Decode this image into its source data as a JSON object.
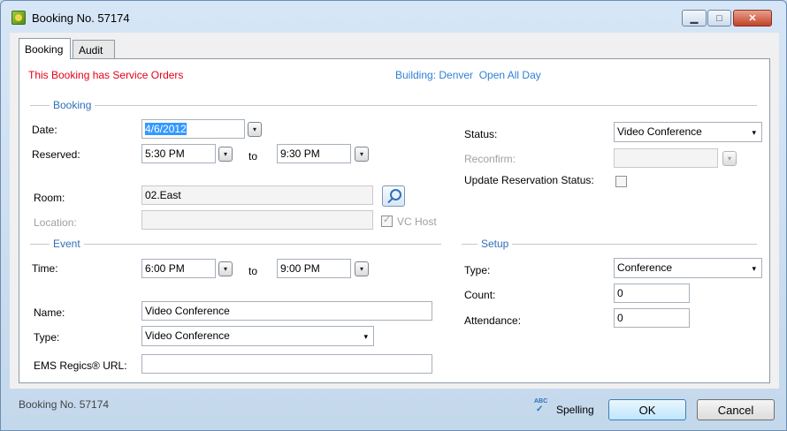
{
  "window": {
    "title": "Booking No. 57174"
  },
  "tabs": [
    {
      "label": "Booking"
    },
    {
      "label": "Audit"
    }
  ],
  "notice": "This Booking has Service Orders",
  "building_info": "Building: Denver  Open All Day",
  "booking_section": {
    "title": "Booking",
    "date_label": "Date:",
    "date_value": "4/6/2012",
    "reserved_label": "Reserved:",
    "reserved_start": "5:30 PM",
    "to_label": "to",
    "reserved_end": "9:30 PM",
    "room_label": "Room:",
    "room_value": "02.East",
    "location_label": "Location:",
    "location_value": "",
    "vc_host_label": "VC Host"
  },
  "status_section": {
    "status_label": "Status:",
    "status_value": "Video Conference",
    "reconfirm_label": "Reconfirm:",
    "reconfirm_value": "",
    "update_status_label": "Update Reservation Status:"
  },
  "event_section": {
    "title": "Event",
    "time_label": "Time:",
    "time_start": "6:00 PM",
    "to_label": "to",
    "time_end": "9:00 PM",
    "name_label": "Name:",
    "name_value": "Video Conference",
    "type_label": "Type:",
    "type_value": "Video Conference",
    "url_label": "EMS Regics® URL:",
    "url_value": ""
  },
  "setup_section": {
    "title": "Setup",
    "type_label": "Type:",
    "type_value": "Conference",
    "count_label": "Count:",
    "count_value": "0",
    "attendance_label": "Attendance:",
    "attendance_value": "0"
  },
  "footer": {
    "status_text": "Booking No. 57174",
    "spelling_label": "Spelling",
    "spell_icon_text": "ABC",
    "ok_label": "OK",
    "cancel_label": "Cancel"
  },
  "icons": {
    "dropdown": "▾",
    "minimize": "▁",
    "maximize": "□",
    "close": "✕"
  },
  "colors": {
    "notice": "#e3001b",
    "link": "#2f7fd6",
    "section": "#2f6fb8",
    "selection": "#3399ff"
  }
}
